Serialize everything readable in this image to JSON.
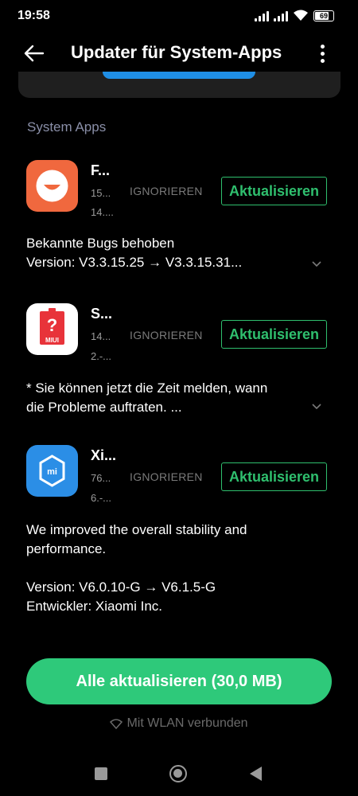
{
  "status_bar": {
    "time": "19:58",
    "battery": "69"
  },
  "header": {
    "title": "Updater für System-Apps"
  },
  "section": {
    "label": "System Apps"
  },
  "apps": [
    {
      "name": "F...",
      "size": "15...",
      "date": "14....",
      "ignore_label": "IGNORIEREN",
      "update_label": "Aktualisieren",
      "desc_line1": "Bekannte Bugs behoben",
      "desc_line2": "Version: V3.3.15.25 → V3.3.15.31...",
      "icon": "smile-face-icon",
      "icon_color": "#f0683e"
    },
    {
      "name": "S...",
      "size": "14...",
      "date": "2.-...",
      "ignore_label": "IGNORIEREN",
      "update_label": "Aktualisieren",
      "desc_line1": "* Sie können jetzt die Zeit melden, wann",
      "desc_line2": "die Probleme auftraten. ...",
      "icon": "miui-feedback-icon",
      "icon_color": "#e8333a",
      "icon_badge": "MIUI"
    },
    {
      "name": "Xi...",
      "size": "76...",
      "date": "6.-...",
      "ignore_label": "IGNORIEREN",
      "update_label": "Aktualisieren",
      "desc_line1": "We improved the overall stability and",
      "desc_line2": "performance.",
      "desc_line3": "Version: V6.0.10-G → V6.1.5-G",
      "desc_line4": "Entwickler: Xiaomi Inc.",
      "icon": "xiaomi-store-icon",
      "icon_color": "#2b8ee6"
    }
  ],
  "bottom": {
    "update_all_label": "Alle aktualisieren (30,0 MB)",
    "wifi_status": "Mit WLAN verbunden"
  },
  "colors": {
    "accent": "#2ec97a",
    "update_border": "#2fbf6e",
    "section_label": "#8a8fa8"
  }
}
